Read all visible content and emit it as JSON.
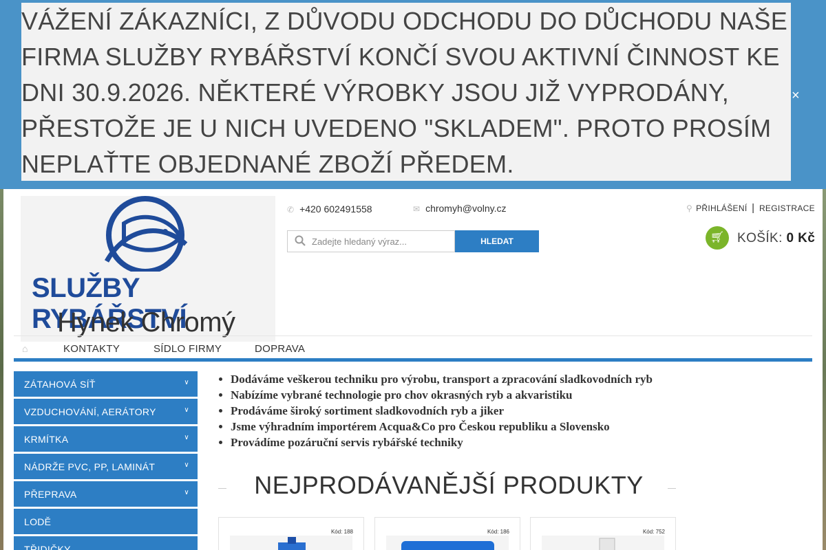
{
  "banner": {
    "message": "VÁŽENÍ ZÁKAZNÍCI, Z DŮVODU ODCHODU DO DŮCHODU NAŠE FIRMA SLUŽBY RYBÁŘSTVÍ KONČÍ SVOU AKTIVNÍ ČINNOST KE DNI 30.9.2026. NĚKTERÉ VÝROBKY JSOU JIŽ VYPRODÁNY, PŘESTOŽE JE U NICH UVEDENO \"SKLADEM\". PROTO PROSÍM NEPLAŤTE OBJEDNANÉ ZBOŽÍ PŘEDEM.",
    "close": "×"
  },
  "logo": {
    "line1": "SLUŽBY RYBÁŘSTVÍ",
    "line2": "Hynek Chromý"
  },
  "header": {
    "phone": "+420 602491558",
    "email": "chromyh@volny.cz",
    "search_placeholder": "Zadejte hledaný výraz...",
    "search_button": "HLEDAT",
    "login": "PŘIHLÁŠENÍ",
    "separator": "|",
    "register": "REGISTRACE",
    "cart_label": "KOŠÍK:",
    "cart_value": "0 Kč"
  },
  "nav": {
    "items": [
      "KONTAKTY",
      "SÍDLO FIRMY",
      "DOPRAVA"
    ]
  },
  "sidebar": {
    "items": [
      "ZÁTAHOVÁ SÍŤ",
      "VZDUCHOVÁNÍ, AERÁTORY",
      "KRMÍTKA",
      "NÁDRŽE PVC, PP, LAMINÁT",
      "PŘEPRAVA",
      "LODĚ",
      "TŘIDIČKY"
    ]
  },
  "intro": {
    "items": [
      "Dodáváme veškerou techniku pro výrobu, transport a zpracování sladkovodních ryb",
      "Nabízíme vybrané technologie pro chov okrasných ryb a akvaristiku",
      "Prodáváme široký sortiment sladkovodních ryb a jiker",
      "Jsme výhradním importérem Acqua&Co pro Českou republiku a Slovensko",
      "Provádíme pozáruční servis rybářské techniky"
    ]
  },
  "bestsellers": {
    "title": "NEJPRODÁVANĚJŠÍ PRODUKTY",
    "products": [
      {
        "code": "Kód: 188"
      },
      {
        "code": "Kód: 186"
      },
      {
        "code": "Kód: 752"
      }
    ]
  },
  "colors": {
    "accent": "#2d7ec4",
    "banner_bg": "#4a93c8",
    "cart": "#7bb52a"
  }
}
